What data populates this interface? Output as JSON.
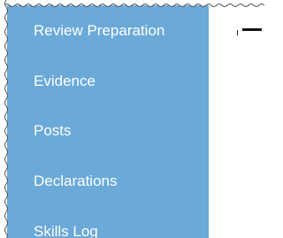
{
  "sidebar": {
    "background_color": "#6aa9d8",
    "text_color": "#ffffff",
    "items": [
      {
        "label": "Review Preparation"
      },
      {
        "label": "Evidence"
      },
      {
        "label": "Posts"
      },
      {
        "label": "Declarations"
      },
      {
        "label": "Skills Log"
      }
    ]
  }
}
